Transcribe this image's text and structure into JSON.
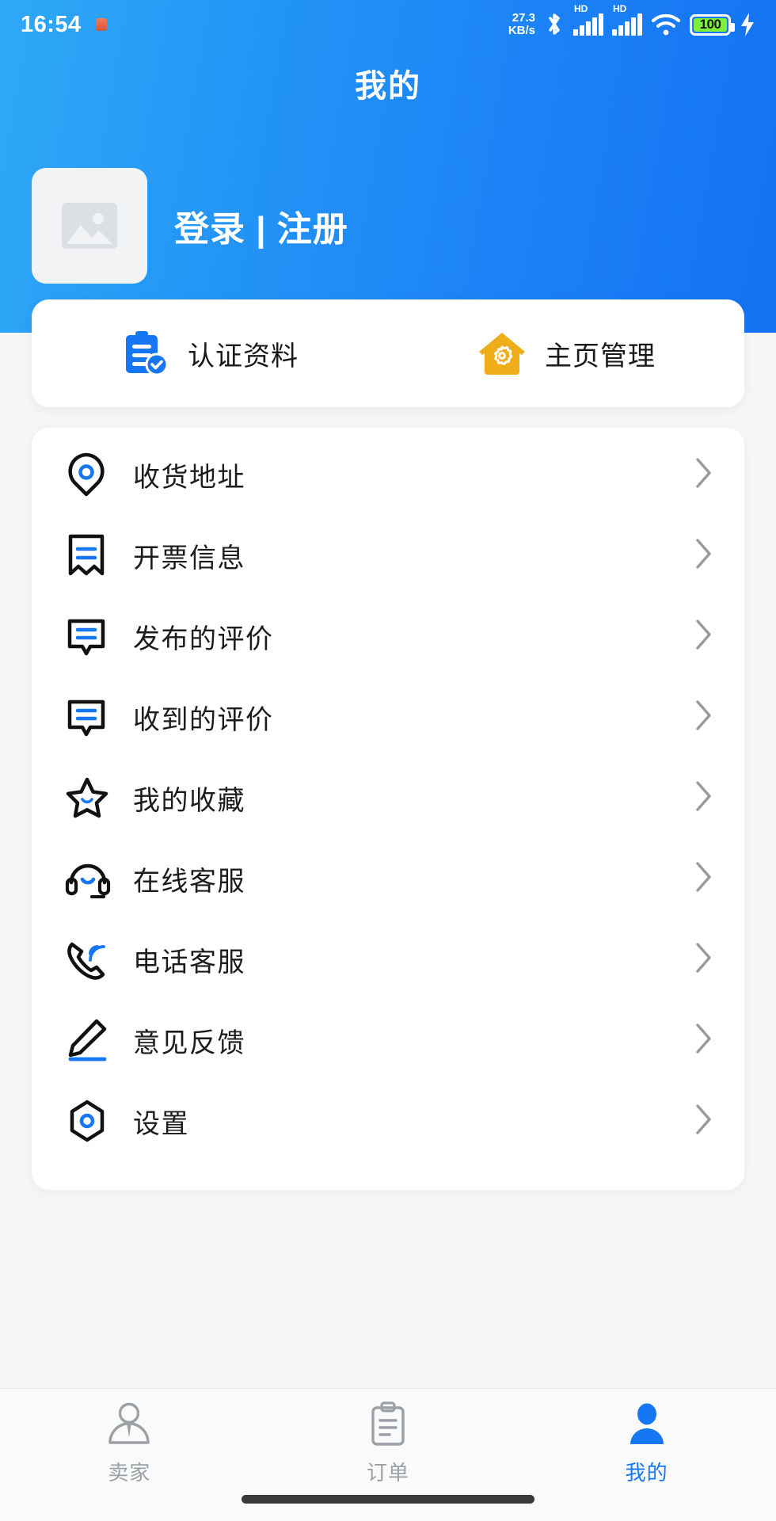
{
  "status_bar": {
    "time": "16:54",
    "net_speed_value": "27.3",
    "net_speed_unit": "KB/s",
    "hd_label_1": "HD",
    "hd_label_2": "HD",
    "battery_percent": "100",
    "icons": [
      "alarm-dot-icon",
      "bluetooth-icon",
      "signal-hd-1-icon",
      "signal-hd-2-icon",
      "wifi-icon",
      "battery-icon",
      "charging-bolt-icon"
    ]
  },
  "header": {
    "title": "我的",
    "gradient_from": "#2fa9f6",
    "gradient_to": "#1272f2",
    "avatar_placeholder": "image-placeholder-icon",
    "login_text": "登录 | 注册"
  },
  "quick_actions": [
    {
      "label": "认证资料",
      "icon": "clipboard-verified-icon",
      "color": "#1677f5"
    },
    {
      "label": "主页管理",
      "icon": "home-gear-icon",
      "color": "#efae19"
    }
  ],
  "menu": {
    "accent_color": "#1677f5",
    "items": [
      {
        "label": "收货地址",
        "icon": "location-pin-icon"
      },
      {
        "label": "开票信息",
        "icon": "invoice-icon"
      },
      {
        "label": "发布的评价",
        "icon": "comment-sent-icon"
      },
      {
        "label": "收到的评价",
        "icon": "comment-received-icon"
      },
      {
        "label": "我的收藏",
        "icon": "star-icon"
      },
      {
        "label": "在线客服",
        "icon": "headset-icon"
      },
      {
        "label": "电话客服",
        "icon": "phone-call-icon"
      },
      {
        "label": "意见反馈",
        "icon": "pencil-feedback-icon"
      },
      {
        "label": "设置",
        "icon": "settings-hexagon-icon"
      }
    ],
    "chevron_icon": "chevron-right-icon"
  },
  "bottom_nav": {
    "active_color": "#1677f5",
    "inactive_color": "#9aa0a6",
    "items": [
      {
        "label": "卖家",
        "icon": "seller-person-icon",
        "active": false
      },
      {
        "label": "订单",
        "icon": "order-clipboard-icon",
        "active": false
      },
      {
        "label": "我的",
        "icon": "profile-person-icon",
        "active": true
      }
    ]
  }
}
